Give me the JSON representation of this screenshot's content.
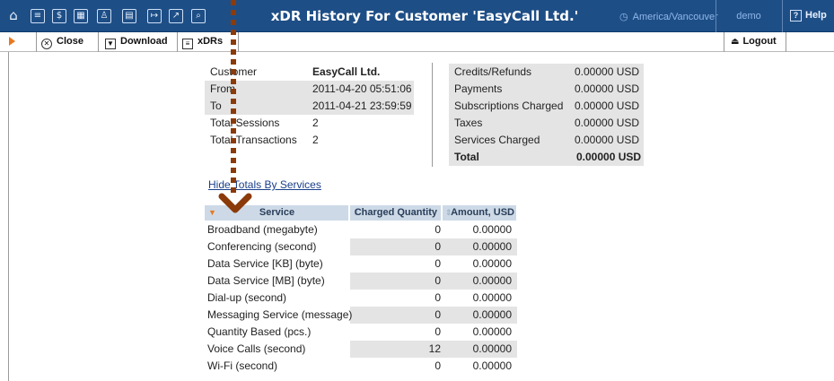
{
  "topbar": {
    "title": "xDR History For Customer 'EasyCall Ltd.'",
    "timezone": "America/Vancouver",
    "user": "demo",
    "help_label": "Help",
    "icons": [
      "home-icon",
      "list-icon",
      "dollar-icon",
      "grid-icon",
      "person-icon",
      "card-icon",
      "arrow-icon",
      "chart-icon",
      "search-icon"
    ]
  },
  "toolbar": {
    "close_label": "Close",
    "download_label": "Download",
    "xdrs_label": "xDRs",
    "logout_label": "Logout"
  },
  "summary": {
    "customer_label": "Customer",
    "customer_value": "EasyCall Ltd.",
    "from_label": "From",
    "from_value": "2011-04-20 05:51:06",
    "to_label": "To",
    "to_value": "2011-04-21 23:59:59",
    "sessions_label": "Total Sessions",
    "sessions_value": "2",
    "transactions_label": "Total Transactions",
    "transactions_value": "2"
  },
  "charges": [
    {
      "label": "Credits/Refunds",
      "value": "0.00000 USD"
    },
    {
      "label": "Payments",
      "value": "0.00000 USD"
    },
    {
      "label": "Subscriptions Charged",
      "value": "0.00000 USD"
    },
    {
      "label": "Taxes",
      "value": "0.00000 USD"
    },
    {
      "label": "Services Charged",
      "value": "0.00000 USD"
    },
    {
      "label": "Total",
      "value": "0.00000 USD"
    }
  ],
  "hide_link": "Hide Totals By Services",
  "services_table": {
    "headers": [
      "Service",
      "Charged Quantity",
      "Amount, USD"
    ],
    "rows": [
      [
        "Broadband (megabyte)",
        "0",
        "0.00000"
      ],
      [
        "Conferencing (second)",
        "0",
        "0.00000"
      ],
      [
        "Data Service [KB] (byte)",
        "0",
        "0.00000"
      ],
      [
        "Data Service [MB] (byte)",
        "0",
        "0.00000"
      ],
      [
        "Dial-up (second)",
        "0",
        "0.00000"
      ],
      [
        "Messaging Service (message)",
        "0",
        "0.00000"
      ],
      [
        "Quantity Based (pcs.)",
        "0",
        "0.00000"
      ],
      [
        "Voice Calls (second)",
        "12",
        "0.00000"
      ],
      [
        "Wi-Fi (second)",
        "0",
        "0.00000"
      ]
    ]
  },
  "colors": {
    "topbar": "#1e4e86",
    "accent": "#e8781f",
    "header_cell": "#cdd9e6",
    "alt_row": "#e4e4e4",
    "annotation": "#8b3a0a"
  }
}
